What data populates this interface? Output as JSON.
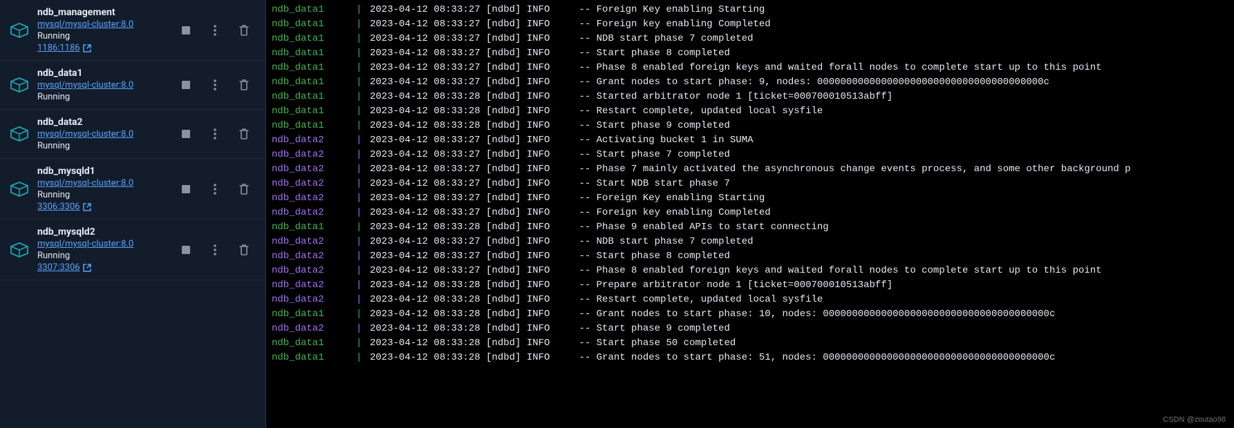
{
  "containers": [
    {
      "name": "ndb_management",
      "image": "mysql/mysql-cluster:8.0",
      "status": "Running",
      "port": "1186:1186"
    },
    {
      "name": "ndb_data1",
      "image": "mysql/mysql-cluster:8.0",
      "status": "Running",
      "port": null
    },
    {
      "name": "ndb_data2",
      "image": "mysql/mysql-cluster:8.0",
      "status": "Running",
      "port": null
    },
    {
      "name": "ndb_mysqld1",
      "image": "mysql/mysql-cluster:8.0",
      "status": "Running",
      "port": "3306:3306"
    },
    {
      "name": "ndb_mysqld2",
      "image": "mysql/mysql-cluster:8.0",
      "status": "Running",
      "port": "3307:3306"
    }
  ],
  "logs": [
    {
      "source": "ndb_data1",
      "color": "green",
      "text": "2023-04-12 08:33:27 [ndbd] INFO     -- Foreign Key enabling Starting"
    },
    {
      "source": "ndb_data1",
      "color": "green",
      "text": "2023-04-12 08:33:27 [ndbd] INFO     -- Foreign key enabling Completed"
    },
    {
      "source": "ndb_data1",
      "color": "green",
      "text": "2023-04-12 08:33:27 [ndbd] INFO     -- NDB start phase 7 completed"
    },
    {
      "source": "ndb_data1",
      "color": "green",
      "text": "2023-04-12 08:33:27 [ndbd] INFO     -- Start phase 8 completed"
    },
    {
      "source": "ndb_data1",
      "color": "green",
      "text": "2023-04-12 08:33:27 [ndbd] INFO     -- Phase 8 enabled foreign keys and waited forall nodes to complete start up to this point"
    },
    {
      "source": "ndb_data1",
      "color": "green",
      "text": "2023-04-12 08:33:27 [ndbd] INFO     -- Grant nodes to start phase: 9, nodes: 000000000000000000000000000000000000000c"
    },
    {
      "source": "ndb_data1",
      "color": "green",
      "text": "2023-04-12 08:33:28 [ndbd] INFO     -- Started arbitrator node 1 [ticket=000700010513abff]"
    },
    {
      "source": "ndb_data1",
      "color": "green",
      "text": "2023-04-12 08:33:28 [ndbd] INFO     -- Restart complete, updated local sysfile"
    },
    {
      "source": "ndb_data1",
      "color": "green",
      "text": "2023-04-12 08:33:28 [ndbd] INFO     -- Start phase 9 completed"
    },
    {
      "source": "ndb_data2",
      "color": "purple",
      "text": "2023-04-12 08:33:27 [ndbd] INFO     -- Activating bucket 1 in SUMA"
    },
    {
      "source": "ndb_data2",
      "color": "purple",
      "text": "2023-04-12 08:33:27 [ndbd] INFO     -- Start phase 7 completed"
    },
    {
      "source": "ndb_data2",
      "color": "purple",
      "text": "2023-04-12 08:33:27 [ndbd] INFO     -- Phase 7 mainly activated the asynchronous change events process, and some other background p"
    },
    {
      "source": "ndb_data2",
      "color": "purple",
      "text": "2023-04-12 08:33:27 [ndbd] INFO     -- Start NDB start phase 7"
    },
    {
      "source": "ndb_data2",
      "color": "purple",
      "text": "2023-04-12 08:33:27 [ndbd] INFO     -- Foreign Key enabling Starting"
    },
    {
      "source": "ndb_data2",
      "color": "purple",
      "text": "2023-04-12 08:33:27 [ndbd] INFO     -- Foreign key enabling Completed"
    },
    {
      "source": "ndb_data1",
      "color": "green",
      "text": "2023-04-12 08:33:28 [ndbd] INFO     -- Phase 9 enabled APIs to start connecting"
    },
    {
      "source": "ndb_data2",
      "color": "purple",
      "text": "2023-04-12 08:33:27 [ndbd] INFO     -- NDB start phase 7 completed"
    },
    {
      "source": "ndb_data2",
      "color": "purple",
      "text": "2023-04-12 08:33:27 [ndbd] INFO     -- Start phase 8 completed"
    },
    {
      "source": "ndb_data2",
      "color": "purple",
      "text": "2023-04-12 08:33:27 [ndbd] INFO     -- Phase 8 enabled foreign keys and waited forall nodes to complete start up to this point"
    },
    {
      "source": "ndb_data2",
      "color": "purple",
      "text": "2023-04-12 08:33:28 [ndbd] INFO     -- Prepare arbitrator node 1 [ticket=000700010513abff]"
    },
    {
      "source": "ndb_data2",
      "color": "purple",
      "text": "2023-04-12 08:33:28 [ndbd] INFO     -- Restart complete, updated local sysfile"
    },
    {
      "source": "ndb_data1",
      "color": "green",
      "text": "2023-04-12 08:33:28 [ndbd] INFO     -- Grant nodes to start phase: 10, nodes: 000000000000000000000000000000000000000c"
    },
    {
      "source": "ndb_data2",
      "color": "purple",
      "text": "2023-04-12 08:33:28 [ndbd] INFO     -- Start phase 9 completed"
    },
    {
      "source": "ndb_data1",
      "color": "green",
      "text": "2023-04-12 08:33:28 [ndbd] INFO     -- Start phase 50 completed"
    },
    {
      "source": "ndb_data1",
      "color": "green",
      "text": "2023-04-12 08:33:28 [ndbd] INFO     -- Grant nodes to start phase: 51, nodes: 000000000000000000000000000000000000000c"
    }
  ],
  "watermark": "CSDN @zoutao98"
}
